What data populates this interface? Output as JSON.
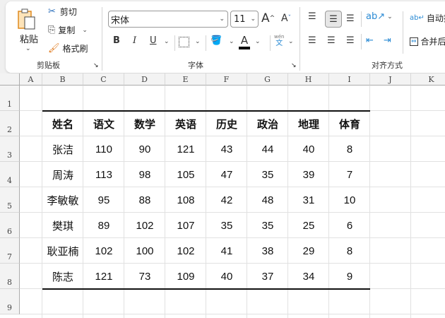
{
  "ribbon": {
    "clipboard": {
      "paste": "粘贴",
      "cut": "剪切",
      "copy": "复制",
      "format_painter": "格式刷",
      "group": "剪贴板"
    },
    "font": {
      "name": "宋体",
      "size": "11",
      "bold": "B",
      "italic": "I",
      "underline": "U",
      "font_color": "A",
      "phonetic": "wén",
      "phonetic_char": "文",
      "group": "字体",
      "grow": "A",
      "shrink": "A"
    },
    "alignment": {
      "group": "对齐方式",
      "wrap": "自动换",
      "merge": "合并后"
    }
  },
  "columns": [
    "A",
    "B",
    "C",
    "D",
    "E",
    "F",
    "G",
    "H",
    "I",
    "J",
    "K"
  ],
  "rows": [
    "1",
    "2",
    "3",
    "4",
    "5",
    "6",
    "7",
    "8",
    "9"
  ],
  "table": {
    "headers": [
      "姓名",
      "语文",
      "数学",
      "英语",
      "历史",
      "政治",
      "地理",
      "体育"
    ],
    "data": [
      [
        "张洁",
        "110",
        "90",
        "121",
        "43",
        "44",
        "40",
        "8"
      ],
      [
        "周涛",
        "113",
        "98",
        "105",
        "47",
        "35",
        "39",
        "7"
      ],
      [
        "李敏敏",
        "95",
        "88",
        "108",
        "42",
        "48",
        "31",
        "10"
      ],
      [
        "樊琪",
        "89",
        "102",
        "107",
        "35",
        "35",
        "25",
        "6"
      ],
      [
        "耿亚楠",
        "102",
        "100",
        "102",
        "41",
        "38",
        "29",
        "8"
      ],
      [
        "陈志",
        "121",
        "73",
        "109",
        "40",
        "37",
        "34",
        "9"
      ]
    ]
  }
}
